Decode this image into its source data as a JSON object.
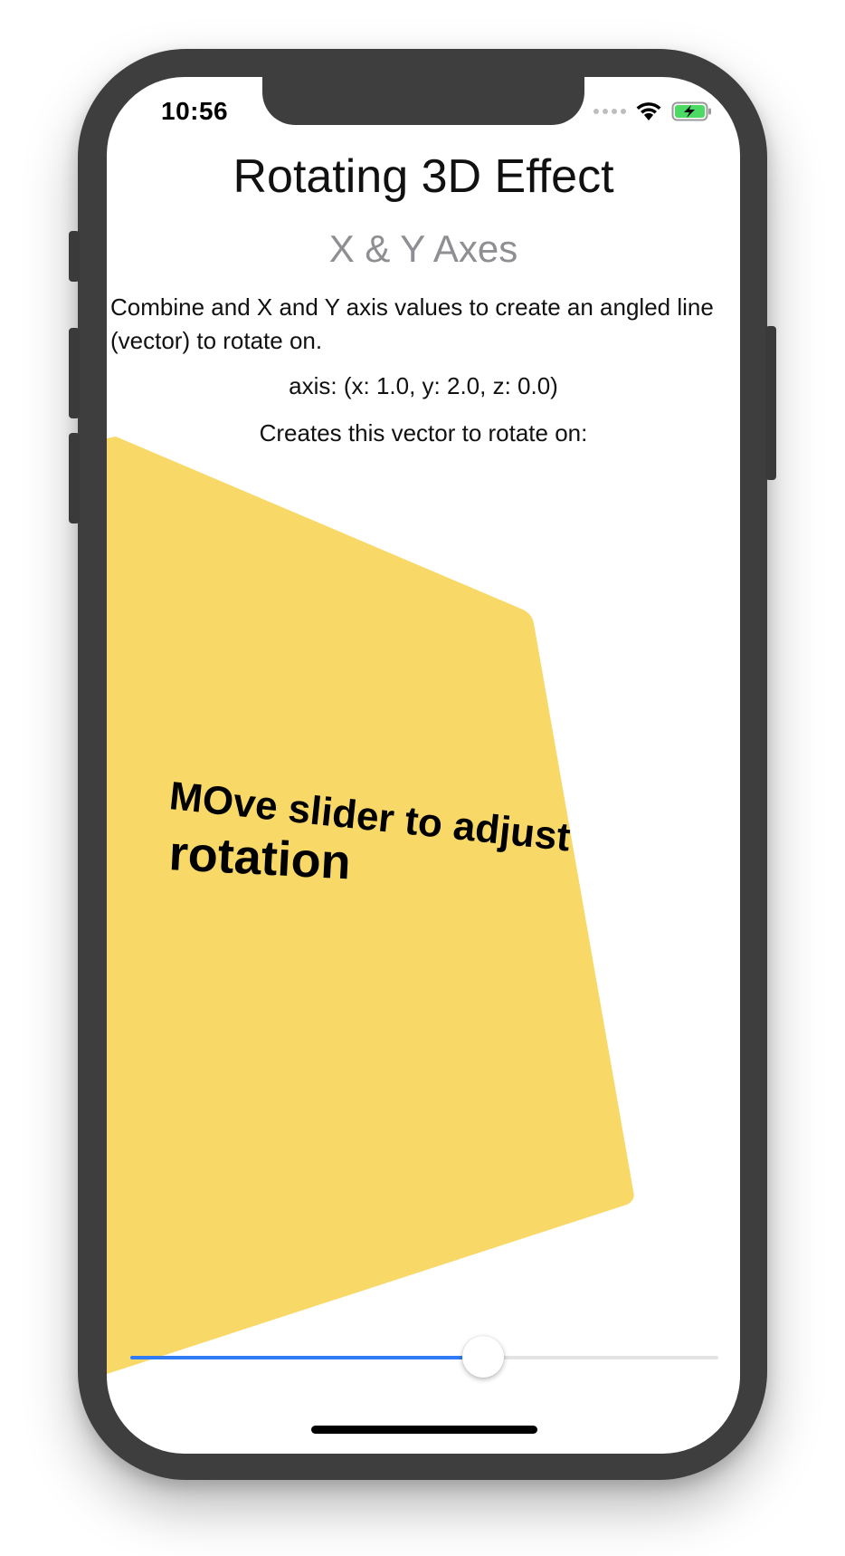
{
  "status_bar": {
    "time": "10:56",
    "icons": [
      "cellular-dots-icon",
      "wifi-icon",
      "battery-charging-icon"
    ]
  },
  "header": {
    "title": "Rotating 3D Effect",
    "subtitle": "X & Y Axes"
  },
  "body": {
    "description": "Combine and X and Y axis values to create an angled line (vector) to rotate on.",
    "axis_text": "axis: (x: 1.0, y: 2.0, z: 0.0)",
    "caption": "Creates this vector to rotate on:"
  },
  "card": {
    "line1": "MOve slider to adjust",
    "line2": "rotation",
    "color": "#F8D968"
  },
  "slider": {
    "value": 0.6,
    "fill_color": "#2F7CF6",
    "track_color": "#E3E3E3"
  }
}
